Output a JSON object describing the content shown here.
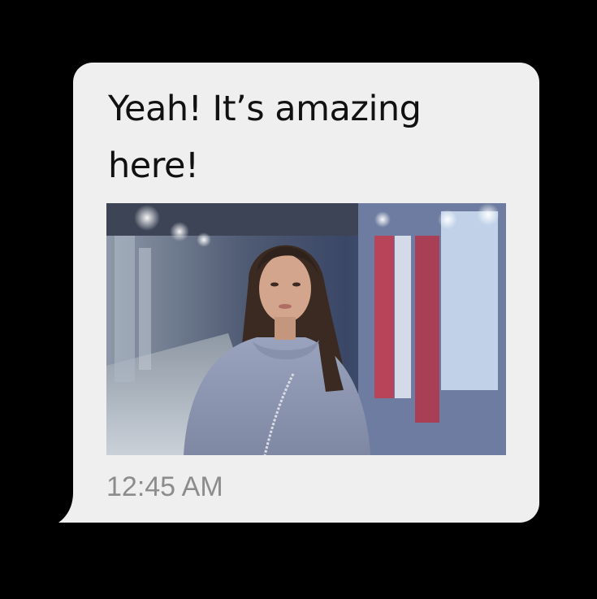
{
  "message": {
    "text": "Yeah! It’s amazing here!",
    "timestamp": "12:45 AM",
    "attachment": {
      "type": "photo",
      "subject": "woman-in-gray-hoodie-subway-platform"
    }
  },
  "colors": {
    "background": "#000000",
    "bubble": "#efefef",
    "text": "#111111",
    "timestamp": "#8c8c8c"
  }
}
